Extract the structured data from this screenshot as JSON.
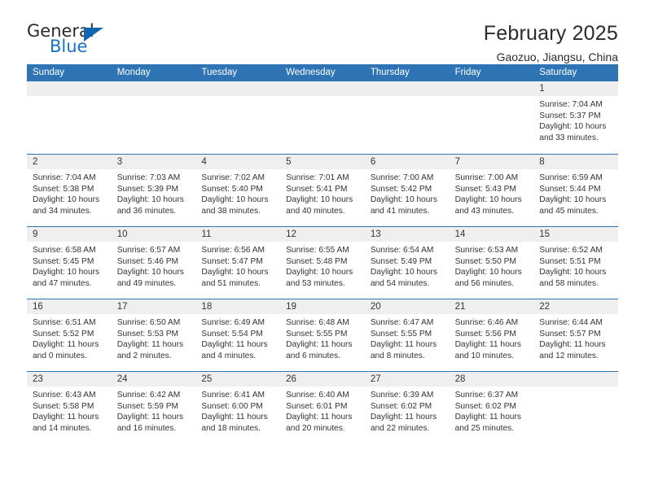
{
  "logo": {
    "primary_text": "General",
    "secondary_text": "Blue",
    "triangle_icon": "triangle-icon",
    "primary_color": "#2a2a2a",
    "secondary_color": "#1473c4"
  },
  "header": {
    "title": "February 2025",
    "subtitle": "Gaozuo, Jiangsu, China"
  },
  "theme": {
    "header_bar_color": "#2e74b5",
    "daynum_band_color": "#efefef",
    "text_color": "#333333"
  },
  "calendar": {
    "weekdays": [
      "Sunday",
      "Monday",
      "Tuesday",
      "Wednesday",
      "Thursday",
      "Friday",
      "Saturday"
    ],
    "labels": {
      "sunrise": "Sunrise:",
      "sunset": "Sunset:",
      "daylight": "Daylight:"
    },
    "weeks": [
      [
        {
          "day": "",
          "empty": true
        },
        {
          "day": "",
          "empty": true
        },
        {
          "day": "",
          "empty": true
        },
        {
          "day": "",
          "empty": true
        },
        {
          "day": "",
          "empty": true
        },
        {
          "day": "",
          "empty": true
        },
        {
          "day": "1",
          "sunrise": "Sunrise: 7:04 AM",
          "sunset": "Sunset: 5:37 PM",
          "daylight": "Daylight: 10 hours and 33 minutes."
        }
      ],
      [
        {
          "day": "2",
          "sunrise": "Sunrise: 7:04 AM",
          "sunset": "Sunset: 5:38 PM",
          "daylight": "Daylight: 10 hours and 34 minutes."
        },
        {
          "day": "3",
          "sunrise": "Sunrise: 7:03 AM",
          "sunset": "Sunset: 5:39 PM",
          "daylight": "Daylight: 10 hours and 36 minutes."
        },
        {
          "day": "4",
          "sunrise": "Sunrise: 7:02 AM",
          "sunset": "Sunset: 5:40 PM",
          "daylight": "Daylight: 10 hours and 38 minutes."
        },
        {
          "day": "5",
          "sunrise": "Sunrise: 7:01 AM",
          "sunset": "Sunset: 5:41 PM",
          "daylight": "Daylight: 10 hours and 40 minutes."
        },
        {
          "day": "6",
          "sunrise": "Sunrise: 7:00 AM",
          "sunset": "Sunset: 5:42 PM",
          "daylight": "Daylight: 10 hours and 41 minutes."
        },
        {
          "day": "7",
          "sunrise": "Sunrise: 7:00 AM",
          "sunset": "Sunset: 5:43 PM",
          "daylight": "Daylight: 10 hours and 43 minutes."
        },
        {
          "day": "8",
          "sunrise": "Sunrise: 6:59 AM",
          "sunset": "Sunset: 5:44 PM",
          "daylight": "Daylight: 10 hours and 45 minutes."
        }
      ],
      [
        {
          "day": "9",
          "sunrise": "Sunrise: 6:58 AM",
          "sunset": "Sunset: 5:45 PM",
          "daylight": "Daylight: 10 hours and 47 minutes."
        },
        {
          "day": "10",
          "sunrise": "Sunrise: 6:57 AM",
          "sunset": "Sunset: 5:46 PM",
          "daylight": "Daylight: 10 hours and 49 minutes."
        },
        {
          "day": "11",
          "sunrise": "Sunrise: 6:56 AM",
          "sunset": "Sunset: 5:47 PM",
          "daylight": "Daylight: 10 hours and 51 minutes."
        },
        {
          "day": "12",
          "sunrise": "Sunrise: 6:55 AM",
          "sunset": "Sunset: 5:48 PM",
          "daylight": "Daylight: 10 hours and 53 minutes."
        },
        {
          "day": "13",
          "sunrise": "Sunrise: 6:54 AM",
          "sunset": "Sunset: 5:49 PM",
          "daylight": "Daylight: 10 hours and 54 minutes."
        },
        {
          "day": "14",
          "sunrise": "Sunrise: 6:53 AM",
          "sunset": "Sunset: 5:50 PM",
          "daylight": "Daylight: 10 hours and 56 minutes."
        },
        {
          "day": "15",
          "sunrise": "Sunrise: 6:52 AM",
          "sunset": "Sunset: 5:51 PM",
          "daylight": "Daylight: 10 hours and 58 minutes."
        }
      ],
      [
        {
          "day": "16",
          "sunrise": "Sunrise: 6:51 AM",
          "sunset": "Sunset: 5:52 PM",
          "daylight": "Daylight: 11 hours and 0 minutes."
        },
        {
          "day": "17",
          "sunrise": "Sunrise: 6:50 AM",
          "sunset": "Sunset: 5:53 PM",
          "daylight": "Daylight: 11 hours and 2 minutes."
        },
        {
          "day": "18",
          "sunrise": "Sunrise: 6:49 AM",
          "sunset": "Sunset: 5:54 PM",
          "daylight": "Daylight: 11 hours and 4 minutes."
        },
        {
          "day": "19",
          "sunrise": "Sunrise: 6:48 AM",
          "sunset": "Sunset: 5:55 PM",
          "daylight": "Daylight: 11 hours and 6 minutes."
        },
        {
          "day": "20",
          "sunrise": "Sunrise: 6:47 AM",
          "sunset": "Sunset: 5:55 PM",
          "daylight": "Daylight: 11 hours and 8 minutes."
        },
        {
          "day": "21",
          "sunrise": "Sunrise: 6:46 AM",
          "sunset": "Sunset: 5:56 PM",
          "daylight": "Daylight: 11 hours and 10 minutes."
        },
        {
          "day": "22",
          "sunrise": "Sunrise: 6:44 AM",
          "sunset": "Sunset: 5:57 PM",
          "daylight": "Daylight: 11 hours and 12 minutes."
        }
      ],
      [
        {
          "day": "23",
          "sunrise": "Sunrise: 6:43 AM",
          "sunset": "Sunset: 5:58 PM",
          "daylight": "Daylight: 11 hours and 14 minutes."
        },
        {
          "day": "24",
          "sunrise": "Sunrise: 6:42 AM",
          "sunset": "Sunset: 5:59 PM",
          "daylight": "Daylight: 11 hours and 16 minutes."
        },
        {
          "day": "25",
          "sunrise": "Sunrise: 6:41 AM",
          "sunset": "Sunset: 6:00 PM",
          "daylight": "Daylight: 11 hours and 18 minutes."
        },
        {
          "day": "26",
          "sunrise": "Sunrise: 6:40 AM",
          "sunset": "Sunset: 6:01 PM",
          "daylight": "Daylight: 11 hours and 20 minutes."
        },
        {
          "day": "27",
          "sunrise": "Sunrise: 6:39 AM",
          "sunset": "Sunset: 6:02 PM",
          "daylight": "Daylight: 11 hours and 22 minutes."
        },
        {
          "day": "28",
          "sunrise": "Sunrise: 6:37 AM",
          "sunset": "Sunset: 6:02 PM",
          "daylight": "Daylight: 11 hours and 25 minutes."
        },
        {
          "day": "",
          "empty": true
        }
      ]
    ]
  }
}
